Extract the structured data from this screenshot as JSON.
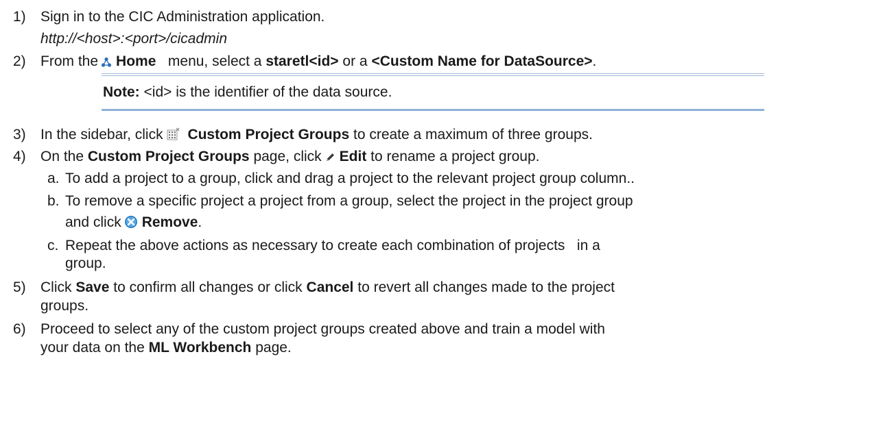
{
  "steps": [
    {
      "num": "1)",
      "text": "Sign in to the CIC Administration application.",
      "url": "http://<host>:<port>/cicadmin"
    },
    {
      "num": "2)",
      "pre": "From the",
      "home": "Home",
      "mid": "menu, select a",
      "staretl": "staretl<id>",
      "or": "or a",
      "custom": "<Custom Name for DataSource>",
      "end": "."
    },
    {
      "num": "3)",
      "pre": "In the sidebar, click",
      "bold": "Custom Project Groups",
      "post": "to create a maximum of three groups."
    },
    {
      "num": "4)",
      "pre": "On the",
      "bold": "Custom Project Groups",
      "mid": "page, click",
      "edit": "Edit",
      "post": "to rename a project group."
    },
    {
      "num": "5)",
      "pre": "Click",
      "save": "Save",
      "mid": "to confirm all changes or click",
      "cancel": "Cancel",
      "post": "to revert all changes made to the project",
      "cont": "groups."
    },
    {
      "num": "6)",
      "text": "Proceed to select any of the custom project groups created above and train a model with",
      "cont_pre": "your data on the",
      "bold": "ML Workbench",
      "cont_post": "page."
    }
  ],
  "note": {
    "label": "Note:",
    "text": "<id> is the identifier of the data source."
  },
  "substeps": [
    {
      "letter": "a.",
      "text": "To add a project to a group, click and drag a project to the relevant project group column.."
    },
    {
      "letter": "b.",
      "text": "To remove a specific project a project from a group, select the project in the project group",
      "cont_pre": "and click",
      "bold": "Remove",
      "cont_post": "."
    },
    {
      "letter": "c.",
      "text": "Repeat the above actions as necessary to create each combination of projects   in a",
      "cont": "group."
    }
  ],
  "icons": {
    "home": "home-icon",
    "custom_groups": "custom-project-groups-icon",
    "edit": "pencil-edit-icon",
    "remove": "remove-x-icon"
  },
  "colors": {
    "text": "#1a1a1a",
    "home_icon": "#2f6fb5",
    "remove_icon": "#2a7fc2",
    "note_rule": "#8fb0d8"
  }
}
